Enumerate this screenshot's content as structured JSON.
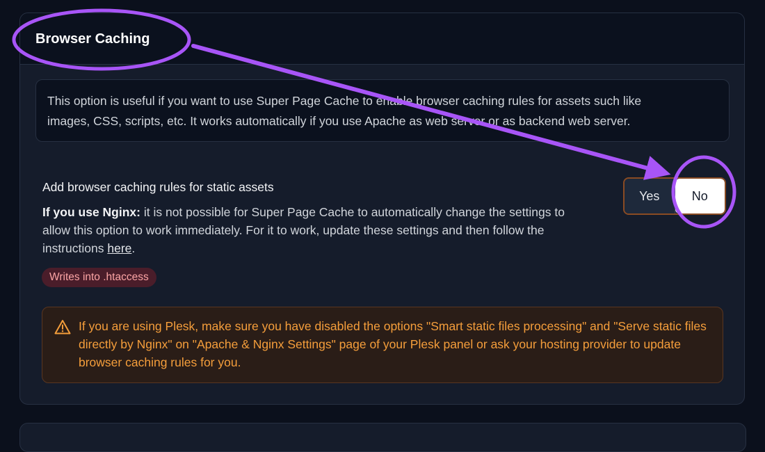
{
  "section": {
    "title": "Browser Caching",
    "info_line1": "This option is useful if you want to use Super Page Cache to enable browser caching rules for assets such like",
    "info_line2": "images, CSS, scripts, etc. It works automatically if you use Apache as web server or as backend web server."
  },
  "setting": {
    "title": "Add browser caching rules for static assets",
    "nginx_label": "If you use Nginx:",
    "desc_part1": " it is not possible for Super Page Cache to automatically change the settings to allow this option to work immediately. For it to work, update these settings and then follow the instructions ",
    "link_text": "here",
    "desc_part2": ".",
    "badge": "Writes into .htaccess",
    "toggle": {
      "yes_label": "Yes",
      "no_label": "No",
      "selected": "No"
    }
  },
  "warning": {
    "icon": "warning-triangle-icon",
    "text": "If you are using Plesk, make sure you have disabled the options \"Smart static files processing\" and \"Serve static files directly by Nginx\" on \"Apache & Nginx Settings\" page of your Plesk panel or ask your hosting provider to update browser caching rules for you."
  },
  "colors": {
    "background": "#0b101c",
    "annotation": "#a855f7",
    "warning_text": "#f59e3b",
    "badge_bg": "#4a1d2a",
    "badge_text": "#fca5a5"
  }
}
